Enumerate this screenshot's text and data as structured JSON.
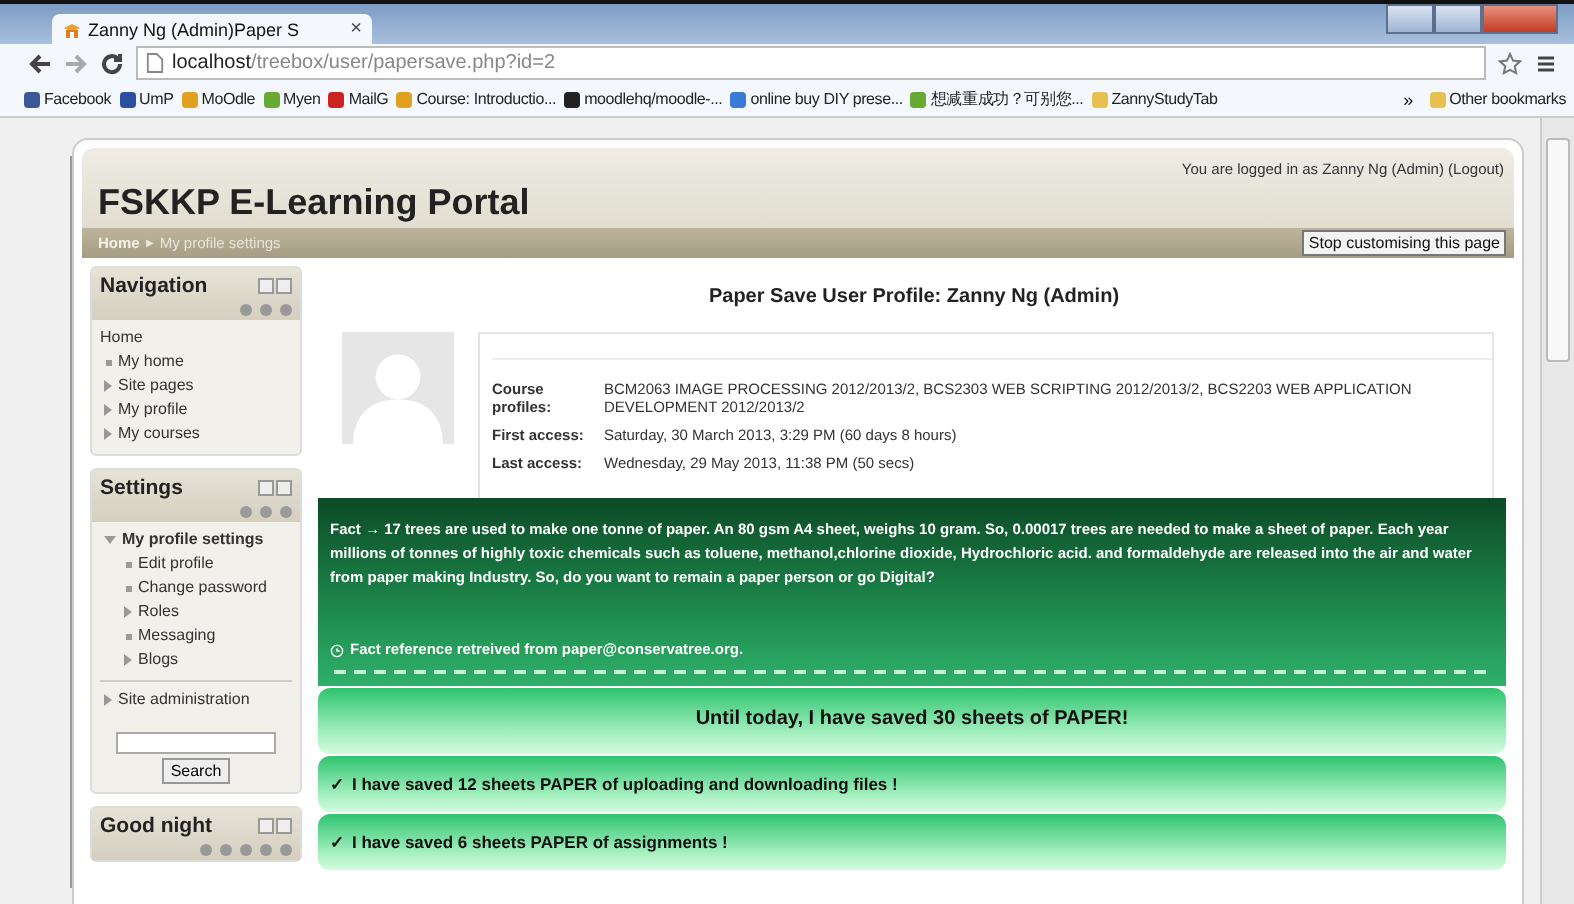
{
  "browser": {
    "tabs": [
      {
        "title": "Zanny Ng (Admin)Paper S",
        "selected": true,
        "close": "×"
      }
    ],
    "address": {
      "host": "localhost",
      "path": "/treebox/user/papersave.php?id=2"
    },
    "bookmarks": [
      {
        "label": "Facebook"
      },
      {
        "label": "UmP"
      },
      {
        "label": "MoOdle"
      },
      {
        "label": "Myen"
      },
      {
        "label": "MailG"
      },
      {
        "label": "Course: Introductio..."
      },
      {
        "label": "moodlehq/moodle-..."
      },
      {
        "label": "online buy DIY prese..."
      },
      {
        "label": "想减重成功？可别您..."
      },
      {
        "label": "ZannyStudyTab"
      }
    ],
    "bookmarks_more": "»",
    "other_bookmarks": "Other bookmarks"
  },
  "header": {
    "title": "FSKKP E-Learning Portal",
    "login_info": "You are logged in as Zanny Ng (Admin) (Logout)",
    "breadcrumb": [
      "Home",
      "My profile settings"
    ],
    "breadcrumb_sep": "▶",
    "customise_button": "Stop customising this page"
  },
  "blocks": [
    {
      "title": "Navigation",
      "items": [
        {
          "label": "Home",
          "kind": "plain"
        },
        {
          "label": "My home",
          "kind": "leaf"
        },
        {
          "label": "Site pages",
          "kind": "branch",
          "expanded": false
        },
        {
          "label": "My profile",
          "kind": "branch",
          "expanded": false
        },
        {
          "label": "My courses",
          "kind": "branch",
          "expanded": false
        }
      ]
    },
    {
      "title": "Settings",
      "items": [
        {
          "label": "My profile settings",
          "kind": "branch",
          "expanded": true,
          "bold": true,
          "children": [
            {
              "label": "Edit profile",
              "kind": "leaf"
            },
            {
              "label": "Change password",
              "kind": "leaf"
            },
            {
              "label": "Roles",
              "kind": "branch",
              "expanded": false
            },
            {
              "label": "Messaging",
              "kind": "leaf"
            },
            {
              "label": "Blogs",
              "kind": "branch",
              "expanded": false
            }
          ]
        },
        {
          "label": "Site administration",
          "kind": "branch",
          "expanded": false,
          "divider": true
        }
      ],
      "search_button": "Search"
    },
    {
      "title": "Good night"
    }
  ],
  "profile": {
    "heading": "Paper Save User Profile: Zanny Ng (Admin)",
    "fields": [
      {
        "label": "Course profiles:",
        "value": "BCM2063 IMAGE PROCESSING 2012/2013/2, BCS2303 WEB SCRIPTING 2012/2013/2, BCS2203 WEB APPLICATION DEVELOPMENT 2012/2013/2"
      },
      {
        "label": "First access:",
        "value": "Saturday, 30 March 2013, 3:29 PM  (60 days 8 hours)"
      },
      {
        "label": "Last access:",
        "value": "Wednesday, 29 May 2013, 11:38 PM  (50 secs)"
      }
    ]
  },
  "fact": {
    "text": "Fact → 17 trees are used to make one tonne of paper. An 80 gsm A4 sheet, weighs 10 gram. So, 0.00017 trees are needed to make a sheet of paper. Each year millions of tonnes of highly toxic chemicals such as toluene, methanol,chlorine dioxide, Hydrochloric acid. and formaldehyde are released into the air and water from paper making Industry. So, do you want to remain a paper person or go Digital?",
    "reference": "Fact reference retreived from paper@conservatree.org."
  },
  "savings": [
    {
      "text": "Until today, I have saved 30 sheets of PAPER!",
      "kind": "total"
    },
    {
      "text": "I have saved 12 sheets PAPER of uploading and downloading files !",
      "kind": "item",
      "mark": "✓"
    },
    {
      "text": "I have saved 6 sheets PAPER of assignments !",
      "kind": "item",
      "mark": "✓"
    }
  ]
}
